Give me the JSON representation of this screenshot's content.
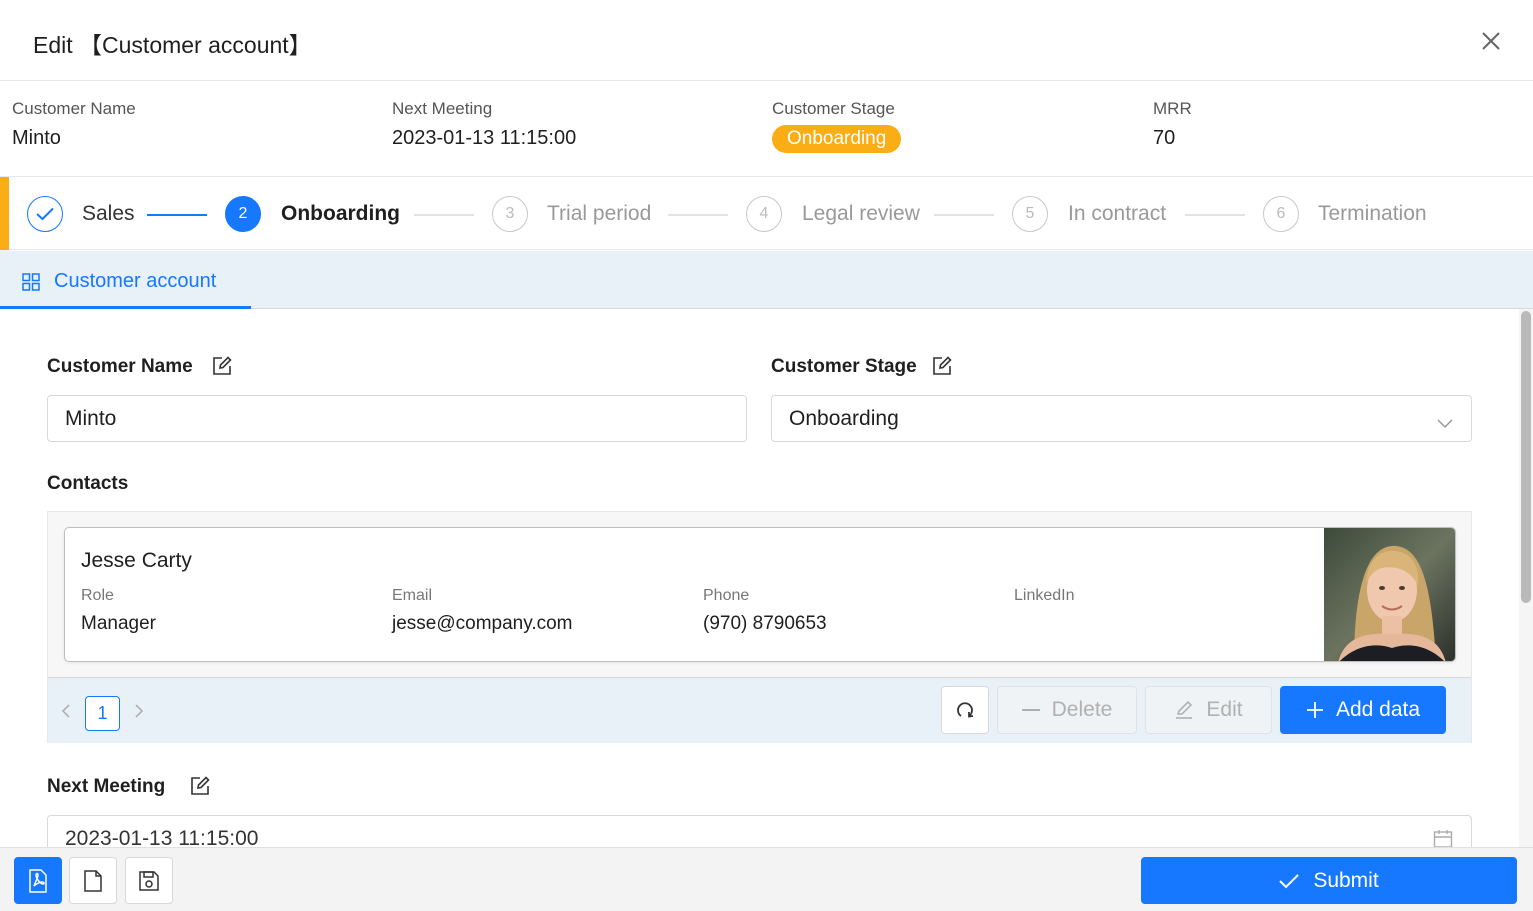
{
  "window": {
    "title": "Edit 【Customer account】"
  },
  "summary": {
    "customer_name_label": "Customer Name",
    "customer_name": "Minto",
    "next_meeting_label": "Next Meeting",
    "next_meeting": "2023-01-13 11:15:00",
    "stage_label": "Customer Stage",
    "stage": "Onboarding",
    "mrr_label": "MRR",
    "mrr": "70"
  },
  "steps": [
    {
      "num": "",
      "label": "Sales",
      "status": "done"
    },
    {
      "num": "2",
      "label": "Onboarding",
      "status": "active"
    },
    {
      "num": "3",
      "label": "Trial period",
      "status": "pending"
    },
    {
      "num": "4",
      "label": "Legal review",
      "status": "pending"
    },
    {
      "num": "5",
      "label": "In contract",
      "status": "pending"
    },
    {
      "num": "6",
      "label": "Termination",
      "status": "pending"
    }
  ],
  "tabs": [
    {
      "label": "Customer account",
      "active": true
    }
  ],
  "form": {
    "customer_name_label": "Customer Name",
    "customer_name_value": "Minto",
    "customer_stage_label": "Customer Stage",
    "customer_stage_value": "Onboarding",
    "contacts_label": "Contacts",
    "next_meeting_label": "Next Meeting",
    "next_meeting_value": "2023-01-13 11:15:00"
  },
  "contact": {
    "name": "Jesse Carty",
    "role_label": "Role",
    "role": "Manager",
    "email_label": "Email",
    "email": "jesse@company.com",
    "phone_label": "Phone",
    "phone": "(970) 8790653",
    "linkedin_label": "LinkedIn",
    "linkedin": ""
  },
  "pager": {
    "current_page": "1"
  },
  "actions": {
    "delete_label": "Delete",
    "edit_label": "Edit",
    "add_label": "Add data"
  },
  "footer": {
    "submit_label": "Submit"
  },
  "colors": {
    "primary": "#1677ff",
    "accent": "#faad14"
  }
}
